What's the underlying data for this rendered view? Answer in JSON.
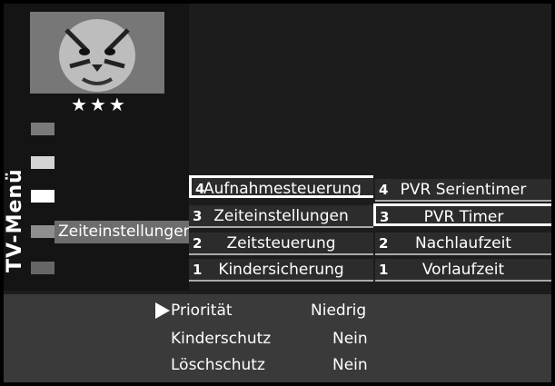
{
  "sidebar": {
    "title": "TV-Menü",
    "rating": "★★★",
    "active_label": "Zeiteinstellungen"
  },
  "middle_menu": [
    {
      "num": "4",
      "label": "Aufnahmesteuerung",
      "selected": true
    },
    {
      "num": "3",
      "label": "Zeiteinstellungen"
    },
    {
      "num": "2",
      "label": "Zeitsteuerung"
    },
    {
      "num": "1",
      "label": "Kindersicherung"
    }
  ],
  "right_menu": [
    {
      "num": "4",
      "label": "PVR Serientimer"
    },
    {
      "num": "3",
      "label": "PVR Timer",
      "selected": true
    },
    {
      "num": "2",
      "label": "Nachlaufzeit"
    },
    {
      "num": "1",
      "label": "Vorlaufzeit"
    }
  ],
  "settings": [
    {
      "label": "Priorität",
      "value": "Niedrig",
      "focused": true
    },
    {
      "label": "Kinderschutz",
      "value": "Nein"
    },
    {
      "label": "Löschschutz",
      "value": "Nein"
    }
  ]
}
